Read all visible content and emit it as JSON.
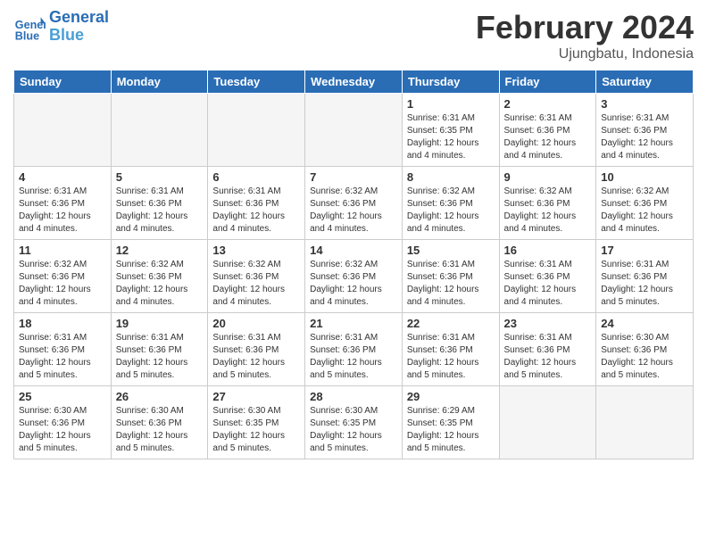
{
  "logo": {
    "text_general": "General",
    "text_blue": "Blue"
  },
  "title": "February 2024",
  "subtitle": "Ujungbatu, Indonesia",
  "days_of_week": [
    "Sunday",
    "Monday",
    "Tuesday",
    "Wednesday",
    "Thursday",
    "Friday",
    "Saturday"
  ],
  "weeks": [
    [
      {
        "day": "",
        "empty": true
      },
      {
        "day": "",
        "empty": true
      },
      {
        "day": "",
        "empty": true
      },
      {
        "day": "",
        "empty": true
      },
      {
        "day": "1",
        "sunrise": "Sunrise: 6:31 AM",
        "sunset": "Sunset: 6:35 PM",
        "daylight": "Daylight: 12 hours and 4 minutes."
      },
      {
        "day": "2",
        "sunrise": "Sunrise: 6:31 AM",
        "sunset": "Sunset: 6:36 PM",
        "daylight": "Daylight: 12 hours and 4 minutes."
      },
      {
        "day": "3",
        "sunrise": "Sunrise: 6:31 AM",
        "sunset": "Sunset: 6:36 PM",
        "daylight": "Daylight: 12 hours and 4 minutes."
      }
    ],
    [
      {
        "day": "4",
        "sunrise": "Sunrise: 6:31 AM",
        "sunset": "Sunset: 6:36 PM",
        "daylight": "Daylight: 12 hours and 4 minutes."
      },
      {
        "day": "5",
        "sunrise": "Sunrise: 6:31 AM",
        "sunset": "Sunset: 6:36 PM",
        "daylight": "Daylight: 12 hours and 4 minutes."
      },
      {
        "day": "6",
        "sunrise": "Sunrise: 6:31 AM",
        "sunset": "Sunset: 6:36 PM",
        "daylight": "Daylight: 12 hours and 4 minutes."
      },
      {
        "day": "7",
        "sunrise": "Sunrise: 6:32 AM",
        "sunset": "Sunset: 6:36 PM",
        "daylight": "Daylight: 12 hours and 4 minutes."
      },
      {
        "day": "8",
        "sunrise": "Sunrise: 6:32 AM",
        "sunset": "Sunset: 6:36 PM",
        "daylight": "Daylight: 12 hours and 4 minutes."
      },
      {
        "day": "9",
        "sunrise": "Sunrise: 6:32 AM",
        "sunset": "Sunset: 6:36 PM",
        "daylight": "Daylight: 12 hours and 4 minutes."
      },
      {
        "day": "10",
        "sunrise": "Sunrise: 6:32 AM",
        "sunset": "Sunset: 6:36 PM",
        "daylight": "Daylight: 12 hours and 4 minutes."
      }
    ],
    [
      {
        "day": "11",
        "sunrise": "Sunrise: 6:32 AM",
        "sunset": "Sunset: 6:36 PM",
        "daylight": "Daylight: 12 hours and 4 minutes."
      },
      {
        "day": "12",
        "sunrise": "Sunrise: 6:32 AM",
        "sunset": "Sunset: 6:36 PM",
        "daylight": "Daylight: 12 hours and 4 minutes."
      },
      {
        "day": "13",
        "sunrise": "Sunrise: 6:32 AM",
        "sunset": "Sunset: 6:36 PM",
        "daylight": "Daylight: 12 hours and 4 minutes."
      },
      {
        "day": "14",
        "sunrise": "Sunrise: 6:32 AM",
        "sunset": "Sunset: 6:36 PM",
        "daylight": "Daylight: 12 hours and 4 minutes."
      },
      {
        "day": "15",
        "sunrise": "Sunrise: 6:31 AM",
        "sunset": "Sunset: 6:36 PM",
        "daylight": "Daylight: 12 hours and 4 minutes."
      },
      {
        "day": "16",
        "sunrise": "Sunrise: 6:31 AM",
        "sunset": "Sunset: 6:36 PM",
        "daylight": "Daylight: 12 hours and 4 minutes."
      },
      {
        "day": "17",
        "sunrise": "Sunrise: 6:31 AM",
        "sunset": "Sunset: 6:36 PM",
        "daylight": "Daylight: 12 hours and 5 minutes."
      }
    ],
    [
      {
        "day": "18",
        "sunrise": "Sunrise: 6:31 AM",
        "sunset": "Sunset: 6:36 PM",
        "daylight": "Daylight: 12 hours and 5 minutes."
      },
      {
        "day": "19",
        "sunrise": "Sunrise: 6:31 AM",
        "sunset": "Sunset: 6:36 PM",
        "daylight": "Daylight: 12 hours and 5 minutes."
      },
      {
        "day": "20",
        "sunrise": "Sunrise: 6:31 AM",
        "sunset": "Sunset: 6:36 PM",
        "daylight": "Daylight: 12 hours and 5 minutes."
      },
      {
        "day": "21",
        "sunrise": "Sunrise: 6:31 AM",
        "sunset": "Sunset: 6:36 PM",
        "daylight": "Daylight: 12 hours and 5 minutes."
      },
      {
        "day": "22",
        "sunrise": "Sunrise: 6:31 AM",
        "sunset": "Sunset: 6:36 PM",
        "daylight": "Daylight: 12 hours and 5 minutes."
      },
      {
        "day": "23",
        "sunrise": "Sunrise: 6:31 AM",
        "sunset": "Sunset: 6:36 PM",
        "daylight": "Daylight: 12 hours and 5 minutes."
      },
      {
        "day": "24",
        "sunrise": "Sunrise: 6:30 AM",
        "sunset": "Sunset: 6:36 PM",
        "daylight": "Daylight: 12 hours and 5 minutes."
      }
    ],
    [
      {
        "day": "25",
        "sunrise": "Sunrise: 6:30 AM",
        "sunset": "Sunset: 6:36 PM",
        "daylight": "Daylight: 12 hours and 5 minutes."
      },
      {
        "day": "26",
        "sunrise": "Sunrise: 6:30 AM",
        "sunset": "Sunset: 6:36 PM",
        "daylight": "Daylight: 12 hours and 5 minutes."
      },
      {
        "day": "27",
        "sunrise": "Sunrise: 6:30 AM",
        "sunset": "Sunset: 6:35 PM",
        "daylight": "Daylight: 12 hours and 5 minutes."
      },
      {
        "day": "28",
        "sunrise": "Sunrise: 6:30 AM",
        "sunset": "Sunset: 6:35 PM",
        "daylight": "Daylight: 12 hours and 5 minutes."
      },
      {
        "day": "29",
        "sunrise": "Sunrise: 6:29 AM",
        "sunset": "Sunset: 6:35 PM",
        "daylight": "Daylight: 12 hours and 5 minutes."
      },
      {
        "day": "",
        "empty": true
      },
      {
        "day": "",
        "empty": true
      }
    ]
  ]
}
